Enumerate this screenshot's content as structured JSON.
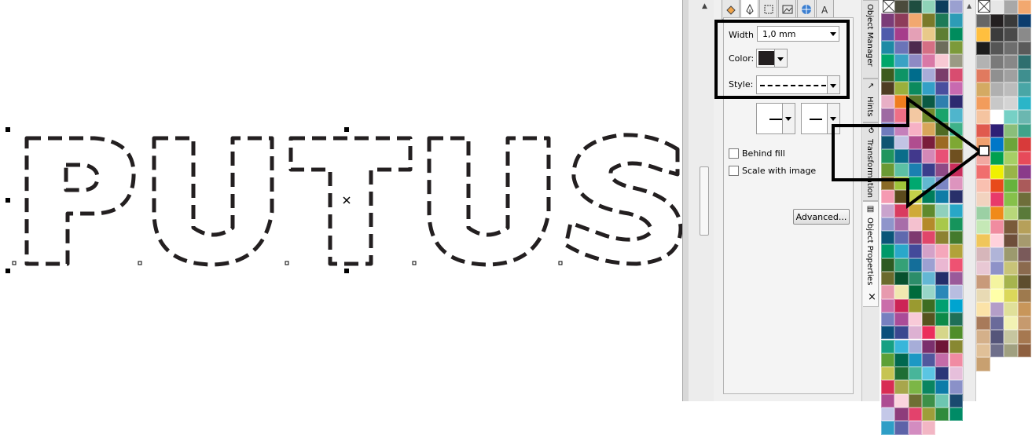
{
  "canvas": {
    "artwork_text": "PUTUS",
    "outline_color": "#231f20"
  },
  "props": {
    "width_label": "Width",
    "width_value": "1,0 mm",
    "color_label": "Color:",
    "color_value": "#231f20",
    "style_label": "Style:",
    "behind_fill_label": "Behind fill",
    "scale_with_image_label": "Scale with image",
    "advanced_label": "Advanced...",
    "tabs": [
      "fill-icon",
      "pen-nib-icon",
      "frame-icon",
      "image-icon",
      "internet-icon",
      "text-icon"
    ]
  },
  "docker_tabs": {
    "object_manager": "Object Manager",
    "hints": "Hints",
    "transformation": "Transformation",
    "object_properties": "Object Properties"
  },
  "palette1_colors": [
    "#4b4b3c",
    "#1f4d40",
    "#8fd3b8",
    "#0b3d5c",
    "#9aa0d0",
    "#7b3c78",
    "#8e3c5a",
    "#f2a86f",
    "#7a7a2a",
    "#1d7a57",
    "#2d9cb6",
    "#4f5bab",
    "#a63d8b",
    "#e4a0b6",
    "#e8c98a",
    "#5e7e33",
    "#008c5d",
    "#1d8aa5",
    "#6b74b8",
    "#4e2a4f",
    "#d56f84",
    "#6d6d5b",
    "#7c9a3a",
    "#00a66a",
    "#3aa2c4",
    "#8e8ac4",
    "#d978a6",
    "#f8c9d4",
    "#9a9a84",
    "#3d5b1f",
    "#0e9466",
    "#006c8c",
    "#a8acd8",
    "#7a3d6a",
    "#d84d70",
    "#4e3c22",
    "#9ab03c",
    "#0b8a5e",
    "#33a0c7",
    "#4a4f9e",
    "#c86ab0",
    "#e8b0c6",
    "#ef7d1e",
    "#59782b",
    "#0a5a44",
    "#2f7fae",
    "#2d2a70",
    "#9e6aa2",
    "#ef6f86",
    "#f3c8a2",
    "#718b2c",
    "#1aa36b",
    "#4fb5cc",
    "#6f7bbc",
    "#c580bb",
    "#f6b1c5",
    "#d8a65a",
    "#4f6b24",
    "#3fb28a",
    "#0f5572",
    "#c2c4e4",
    "#b04d8f",
    "#7a1d3b",
    "#9c6a22",
    "#7ea833",
    "#21955e",
    "#0a6d8a",
    "#41388c",
    "#d488b7",
    "#e85076",
    "#6f5020",
    "#6b9a34",
    "#5cc0a4",
    "#1b7fb0",
    "#3a3e8c",
    "#8e4a86",
    "#c82d5c",
    "#8a6a26",
    "#9fc43a",
    "#00a86f",
    "#62b8d0",
    "#7b86c4",
    "#dd94be",
    "#f59ab2",
    "#5b4a1c",
    "#c2d04a",
    "#007d5a",
    "#0f7ca6",
    "#28306a",
    "#c9a3cd",
    "#d93b60",
    "#cfaa38",
    "#5f8a2d",
    "#8fd0bc",
    "#28a7c7",
    "#8f95cb",
    "#a86da9",
    "#f4c1cf",
    "#b48a2a",
    "#a8c84a",
    "#16945c",
    "#0a5578",
    "#5f69ae",
    "#7e3a70",
    "#e0466a",
    "#8d8232",
    "#447a2d",
    "#00996a",
    "#2aa8ca",
    "#434a9a",
    "#d4a1c8",
    "#f5a7bb",
    "#b1a23a",
    "#2e5a22",
    "#35a177",
    "#146e9a",
    "#9ca0d2",
    "#eab7d2",
    "#ee5272",
    "#6b6a2c",
    "#08512e",
    "#2c8d6a",
    "#63b7d4",
    "#242e6a",
    "#9a5a9a",
    "#e79aae",
    "#f0e8b0",
    "#006b3c",
    "#98d6c8",
    "#2a88b8",
    "#b8bde0",
    "#ca6eaa",
    "#cc2456",
    "#9a9a30",
    "#3d6d22",
    "#00a071",
    "#00a4d0",
    "#7780c0",
    "#aa4c98",
    "#f8cad8",
    "#57531f",
    "#0d8a48",
    "#1f6f58",
    "#0b4f7b",
    "#3a4790",
    "#ddb1d2",
    "#eb2e5c",
    "#d6d68a",
    "#4f8d2a",
    "#16a083",
    "#38b6da",
    "#a6add8",
    "#7b2f6c",
    "#6e1536",
    "#888832",
    "#5da036",
    "#00684f",
    "#1c98c4",
    "#51589e",
    "#c46ba8",
    "#f08ba3",
    "#c6c452",
    "#1e6e34",
    "#48b59a",
    "#5bc5e3",
    "#2b3578",
    "#e6bfdb",
    "#d82c54",
    "#a8a64c",
    "#7cb646",
    "#0a8560",
    "#0c7ba8",
    "#8a91c8",
    "#ad4c92",
    "#fbd4de",
    "#6e6f34",
    "#3d9048",
    "#6dc6b1",
    "#1a4a6f",
    "#c4c8e8",
    "#8e3c7b",
    "#e3426c",
    "#9e9e3a",
    "#2f8b3c",
    "#008b66",
    "#2e9ec6",
    "#5d63a8",
    "#d38cc0",
    "#f2b6c4"
  ],
  "palette2_colors": [
    "#e6e6e6",
    "#a8a8a8",
    "#f2a86f",
    "#666666",
    "#231f20",
    "#3a3a3a",
    "#0c3d6e",
    "#ffbf3f",
    "#3c3c3c",
    "#4a4a4a",
    "#8a8a8a",
    "#1c1c1c",
    "#555555",
    "#6e6e6e",
    "#5a5a5a",
    "#b2b2b2",
    "#7a7a7a",
    "#888888",
    "#2f6f6f",
    "#e07a5f",
    "#909090",
    "#a0a0a0",
    "#3f8f8f",
    "#d4aa63",
    "#b0b0b0",
    "#bcbcbc",
    "#49a6a6",
    "#f29c5c",
    "#c8c8c8",
    "#d4d4d4",
    "#2bb5c8",
    "#f5c4a0",
    "#ffffff",
    "#76d0c5",
    "#6bb7b0",
    "#e05a4e",
    "#2e1f76",
    "#8abe7a",
    "#3fa38a",
    "#f0a06e",
    "#0077c8",
    "#6da53a",
    "#d83a3a",
    "#f2a8a0",
    "#00a050",
    "#a6cf65",
    "#e74a5a",
    "#f06e6e",
    "#f0f000",
    "#99b548",
    "#8a3a8a",
    "#f9c0b0",
    "#e84a1a",
    "#66b33d",
    "#aa5a5a",
    "#f2d3bf",
    "#e83a6a",
    "#86c14a",
    "#6e6e3a",
    "#9bd0a4",
    "#f08a1a",
    "#b8d87a",
    "#5a7a3a",
    "#c5e8b6",
    "#f08ca0",
    "#7a5a3a",
    "#b6a05a",
    "#f0c65a",
    "#ffd2dc",
    "#6e4e3a",
    "#a69a6e",
    "#d6b6ba",
    "#b0b4d8",
    "#9c9a6e",
    "#7a5a5a",
    "#e8c8d4",
    "#8e92c8",
    "#c8c478",
    "#8b6a4e",
    "#c89a7a",
    "#f4f4a0",
    "#a6b44e",
    "#5e4e2e",
    "#e8dab4",
    "#ffffa8",
    "#dbd85a",
    "#9e7a4e",
    "#fbe3a8",
    "#b49ec8",
    "#e0e09a",
    "#c8965a",
    "#a87a5a",
    "#6a6a9a",
    "#f2f2b4",
    "#c69a6e",
    "#d4b08a",
    "#55557a",
    "#c6c6a0",
    "#a67850",
    "#e0c098",
    "#6e6e8a",
    "#a0a080",
    "#8e6040",
    "#c8a070"
  ]
}
